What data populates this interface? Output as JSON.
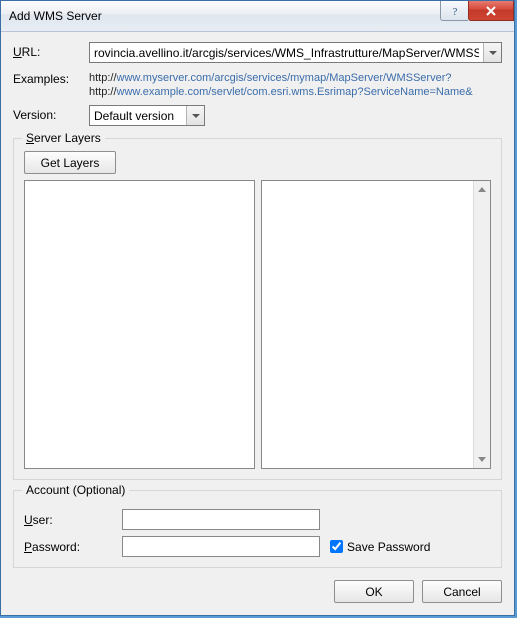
{
  "window": {
    "title": "Add WMS Server"
  },
  "labels": {
    "url_prefix": "U",
    "url_rest": "RL:",
    "examples": "Examples:",
    "version": "Version:",
    "server_layers_prefix": "S",
    "server_layers_rest": "erver Layers",
    "get_layers_prefix": "G",
    "get_layers_rest": "et Layers",
    "account": "Account (Optional)",
    "user_prefix": "U",
    "user_rest": "ser:",
    "password_prefix": "P",
    "password_rest": "assword:",
    "save_password_prefix": "S",
    "save_password_rest": "ave Password",
    "ok": "OK",
    "cancel": "Cancel"
  },
  "url": {
    "value": "rovincia.avellino.it/arcgis/services/WMS_Infrastrutture/MapServer/WMSServer"
  },
  "examples": {
    "line1a": "http://",
    "line1b": "www.myserver.com/arcgis/services/mymap/MapServer/WMSServer?",
    "line2a": "http://",
    "line2b": "www.example.com/servlet/com.esri.wms.Esrimap?ServiceName=Name&"
  },
  "version": {
    "selected": "Default version"
  },
  "account": {
    "user": "",
    "password": "",
    "save_password": true
  }
}
